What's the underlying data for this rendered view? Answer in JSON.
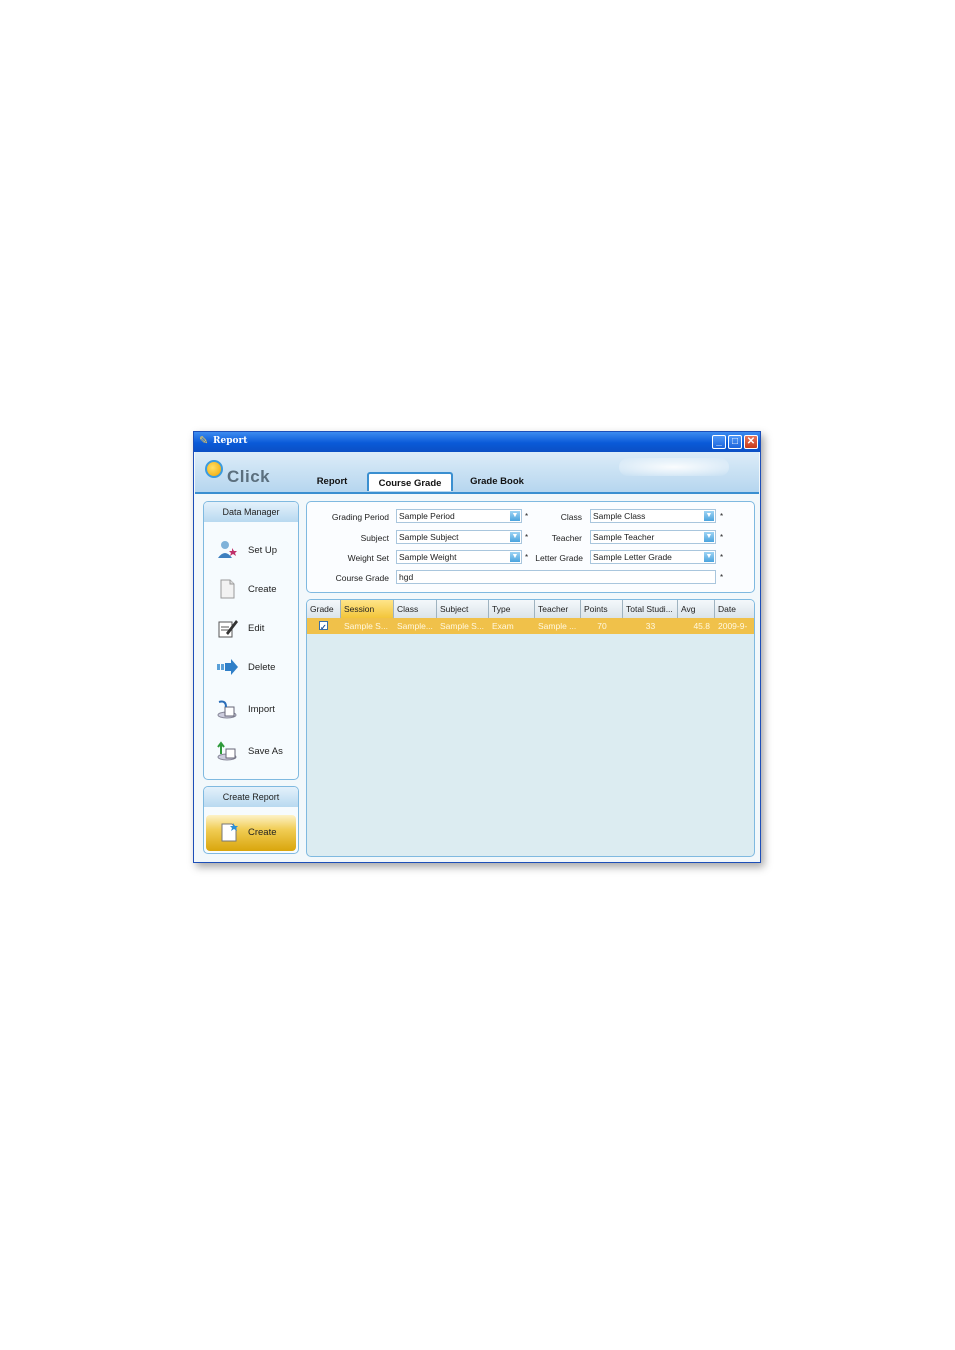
{
  "window": {
    "title": "Report"
  },
  "logo": {
    "text": "Click"
  },
  "tabs": [
    {
      "label": "Report"
    },
    {
      "label": "Course Grade"
    },
    {
      "label": "Grade Book"
    }
  ],
  "sidebar": {
    "header": "Data Manager",
    "items": [
      {
        "label": "Set Up",
        "icon": "user-setup-icon"
      },
      {
        "label": "Create",
        "icon": "document-icon"
      },
      {
        "label": "Edit",
        "icon": "edit-icon"
      },
      {
        "label": "Delete",
        "icon": "delete-arrow-icon"
      },
      {
        "label": "Import",
        "icon": "import-icon"
      },
      {
        "label": "Save As",
        "icon": "save-as-icon"
      }
    ]
  },
  "create_report": {
    "header": "Create Report",
    "button_label": "Create"
  },
  "form": {
    "grading_period": {
      "label": "Grading Period",
      "value": "Sample Period"
    },
    "class": {
      "label": "Class",
      "value": "Sample Class"
    },
    "subject": {
      "label": "Subject",
      "value": "Sample Subject"
    },
    "teacher": {
      "label": "Teacher",
      "value": "Sample Teacher"
    },
    "weight_set": {
      "label": "Weight Set",
      "value": "Sample Weight"
    },
    "letter_grade": {
      "label": "Letter Grade",
      "value": "Sample Letter Grade"
    },
    "course_grade": {
      "label": "Course Grade",
      "value": "hgd"
    },
    "required_mark": "*"
  },
  "table": {
    "columns": [
      "Grade",
      "Session",
      "Class",
      "Subject",
      "Type",
      "Teacher",
      "Points",
      "Total Studi...",
      "Avg",
      "Date"
    ],
    "rows": [
      {
        "checked": true,
        "session": "Sample S...",
        "class": "Sample...",
        "subject": "Sample S...",
        "type": "Exam",
        "teacher": "Sample ...",
        "points": "70",
        "total_students": "33",
        "avg": "45.8",
        "date": "2009-9-"
      }
    ]
  },
  "colors": {
    "title_bar": "#0a5ad8",
    "accent": "#3a8fd0",
    "selected_row": "#f0c14a"
  }
}
